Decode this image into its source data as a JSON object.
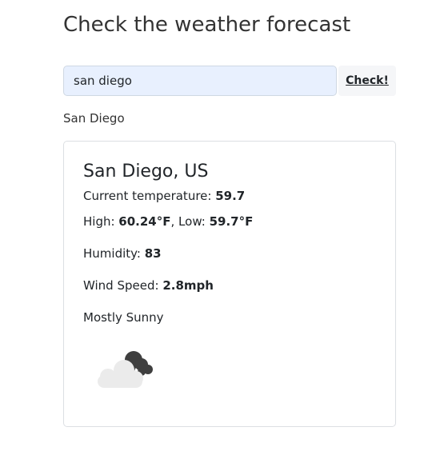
{
  "page": {
    "title": "Check the weather forecast"
  },
  "search": {
    "value": "san diego",
    "button_label": "Check!"
  },
  "location_echo": "San Diego",
  "weather": {
    "city": "San Diego, US",
    "temp_label": "Current temperature: ",
    "temp_value": "59.7",
    "high_label": "High: ",
    "high_value": "60.24°F",
    "sep": ", ",
    "low_label": "Low: ",
    "low_value": "59.7°F",
    "humidity_label": "Humidity: ",
    "humidity_value": "83",
    "wind_label": "Wind Speed: ",
    "wind_value": "2.8mph",
    "description": "Mostly Sunny",
    "icon": "cloud-icon"
  },
  "colors": {
    "input_background": "#e8f0fe",
    "button_background": "#f5f6f8",
    "card_border": "#dcdfe3",
    "dark_cloud": "#3f3f3f",
    "light_cloud": "#ebebeb"
  }
}
